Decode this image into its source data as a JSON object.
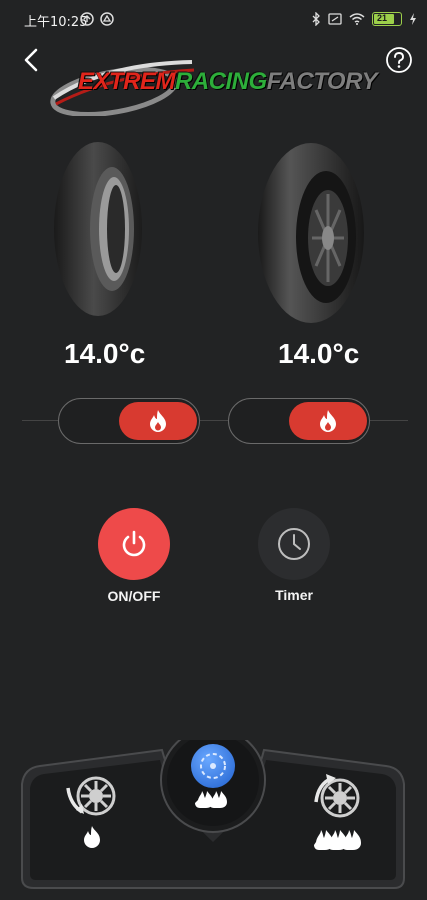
{
  "status_bar": {
    "time": "上午10:25",
    "battery": "21"
  },
  "header": {
    "logo_text": {
      "part1": "EXTREM",
      "part2": "RACING",
      "part3": "FACTORY"
    }
  },
  "tires": {
    "left": {
      "temperature": "14.0°c",
      "heating_on": true
    },
    "right": {
      "temperature": "14.0°c",
      "heating_on": true
    }
  },
  "controls": {
    "power_label": "ON/OFF",
    "timer_label": "Timer"
  },
  "modes": {
    "items": [
      "low-heat-mode",
      "wheel-heat-mode",
      "high-heat-mode"
    ],
    "selected": "wheel-heat-mode"
  },
  "colors": {
    "accent_red": "#ee4a4a",
    "switch_red": "#d83a30",
    "mode_blue": "#3f86ee",
    "background": "#222324"
  }
}
